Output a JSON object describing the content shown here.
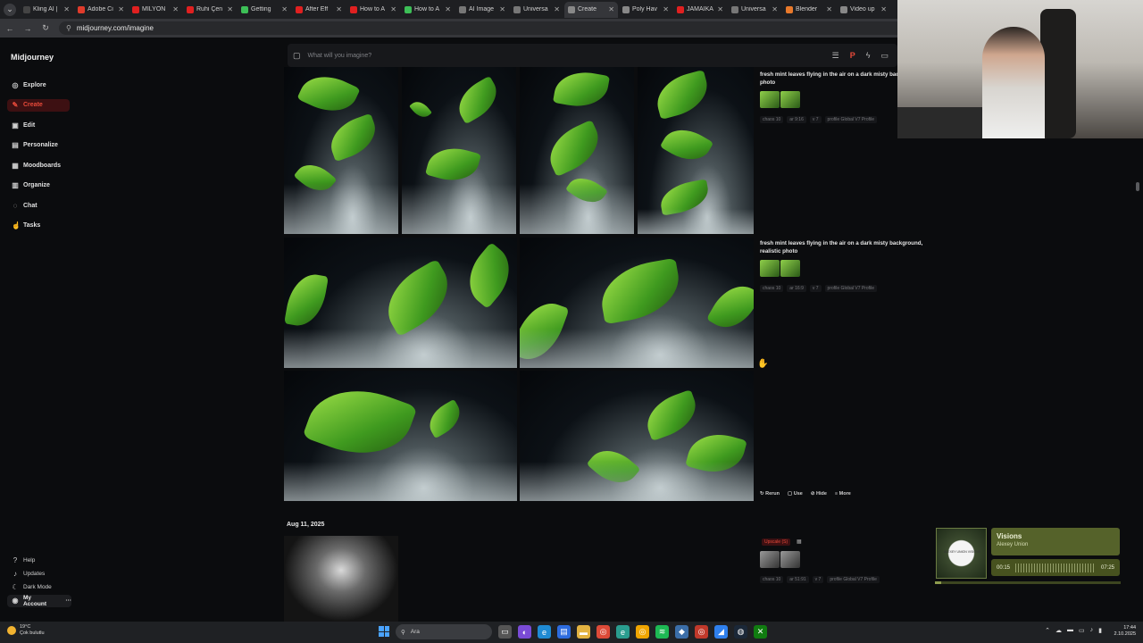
{
  "browser": {
    "tabs": [
      {
        "label": "Kling AI |",
        "color": "#444"
      },
      {
        "label": "Adobe Ci",
        "color": "#e03b2b"
      },
      {
        "label": "MİLYON",
        "color": "#e02020"
      },
      {
        "label": "Ruhi Çen",
        "color": "#e02020"
      },
      {
        "label": "Getting",
        "color": "#3dbf57"
      },
      {
        "label": "After Eff",
        "color": "#e02020"
      },
      {
        "label": "How to A",
        "color": "#e02020"
      },
      {
        "label": "How to A",
        "color": "#3dbf57"
      },
      {
        "label": "AI Image",
        "color": "#777"
      },
      {
        "label": "Universa",
        "color": "#777"
      },
      {
        "label": "Create",
        "color": "#888",
        "active": true
      },
      {
        "label": "Poly Hav",
        "color": "#888"
      },
      {
        "label": "JAMAİKA",
        "color": "#e02020"
      },
      {
        "label": "Universa",
        "color": "#777"
      },
      {
        "label": "Blender",
        "color": "#e8792b"
      },
      {
        "label": "Video up",
        "color": "#888"
      }
    ],
    "url": "midjourney.com/imagine"
  },
  "sidebar": {
    "brand": "Midjourney",
    "items": [
      {
        "label": "Explore",
        "icon": "compass-icon",
        "glyph": "◎"
      },
      {
        "label": "Create",
        "icon": "brush-icon",
        "glyph": "✎",
        "active": true
      },
      {
        "label": "Edit",
        "icon": "edit-icon",
        "glyph": "▣"
      },
      {
        "label": "Personalize",
        "icon": "personalize-icon",
        "glyph": "▤"
      },
      {
        "label": "Moodboards",
        "icon": "moodboard-icon",
        "glyph": "▦"
      },
      {
        "label": "Organize",
        "icon": "folder-icon",
        "glyph": "▥"
      },
      {
        "label": "Chat",
        "icon": "chat-icon",
        "glyph": "◌"
      },
      {
        "label": "Tasks",
        "icon": "thumbs-up-icon",
        "glyph": "☝"
      }
    ],
    "bottom": [
      {
        "label": "Help",
        "icon": "help-icon",
        "glyph": "?"
      },
      {
        "label": "Updates",
        "icon": "bell-icon",
        "glyph": "♪"
      },
      {
        "label": "Dark Mode",
        "icon": "moon-icon",
        "glyph": "☾"
      },
      {
        "label": "My Account",
        "icon": "account-icon",
        "glyph": "◉",
        "suffix": "···"
      }
    ]
  },
  "prompt": {
    "placeholder": "What will you imagine?"
  },
  "jobs": [
    {
      "prompt": "fresh mint leaves flying in the air on a dark misty bac realistic photo",
      "chips": [
        "chaos 10",
        "ar 9:16",
        "v 7",
        "profile Global V7 Profile"
      ]
    },
    {
      "prompt": "fresh mint leaves flying in the air on a dark misty background, realistic photo",
      "chips": [
        "chaos 10",
        "ar 16:9",
        "v 7",
        "profile Global V7 Profile"
      ],
      "actions": [
        "Rerun",
        "Use",
        "Hide",
        "More"
      ]
    }
  ],
  "date_header": "Aug 11, 2025",
  "third_job": {
    "badge": "Upscale (S)",
    "chips": [
      "chaos 10",
      "ar 51:91",
      "v 7",
      "profile Global V7 Profile"
    ]
  },
  "music": {
    "title": "Visions",
    "artist": "Alexey Union",
    "elapsed": "00:15",
    "total": "07:25",
    "progress_fraction": 0.034,
    "cover_text": "ALEXEY UNION VISIONS"
  },
  "taskbar": {
    "temperature": "19°C",
    "weather": "Çok bulutlu",
    "search": "Ara",
    "time": "17:44",
    "date": "2.10.2025"
  }
}
